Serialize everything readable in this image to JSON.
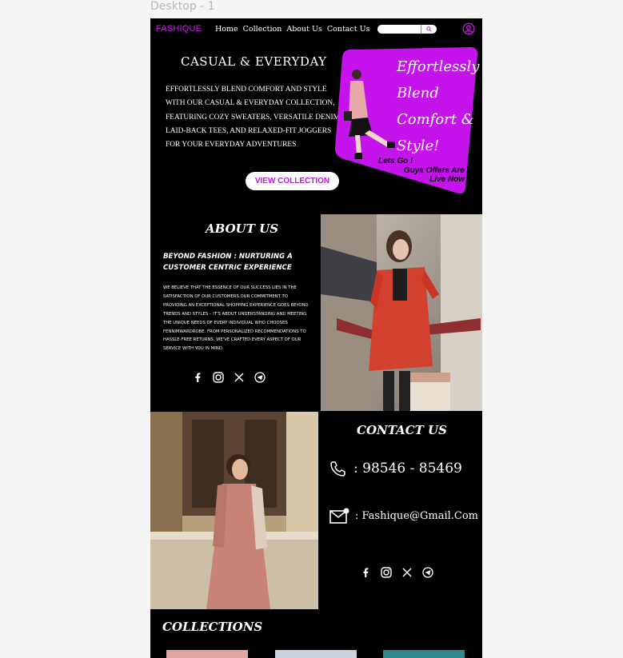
{
  "canvas": {
    "frame_label": "Desktop - 1"
  },
  "nav": {
    "logo": "FASHIQUE",
    "links": [
      "Home",
      "Collection",
      "About Us",
      "Contact Us"
    ],
    "search_placeholder": "",
    "user_icon": "user-circle-icon"
  },
  "hero": {
    "title": "CASUAL & EVERYDAY",
    "text": "Effortlessly blend comfort and style with our casual & everyday collection, featuring cozy sweaters, versatile denim, laid-back tees, and relaxed-fit joggers for your everyday adventures",
    "button": "VIEW COLLECTION",
    "promo_lines": [
      "Effortlessly",
      "Blend",
      "Comfort &",
      "Style!"
    ],
    "promo_sub": [
      "Lets Go !",
      "Guys Offers Are",
      "Live Now"
    ]
  },
  "about": {
    "title": "ABOUT US",
    "subtitle": "Beyond Fashion : Nurturing A Customer Centric Experience",
    "body": "We believe that the essence of our success lies in the satisfaction of our customers.Our commitment to providing an exceptional shopping experience goes beyond trends and styles – it's about understanding and meeting the unique needs of every individual who chooses Fennimwardrobe. From personalized recommendations to hassle-free returns, we've crafted every aspect of our service with you in mind.",
    "social_icons": [
      "facebook-icon",
      "instagram-icon",
      "x-icon",
      "telegram-icon"
    ]
  },
  "contact": {
    "title": "CONTACT US",
    "phone": ": 98546 - 85469",
    "email": ": Fashique@Gmail.Com",
    "social_icons": [
      "facebook-icon",
      "instagram-icon",
      "x-icon",
      "telegram-icon"
    ]
  },
  "collections": {
    "title": "COLLECTIONS"
  },
  "colors": {
    "accent": "#d11bf0",
    "background": "#000000",
    "text": "#ffffff"
  }
}
